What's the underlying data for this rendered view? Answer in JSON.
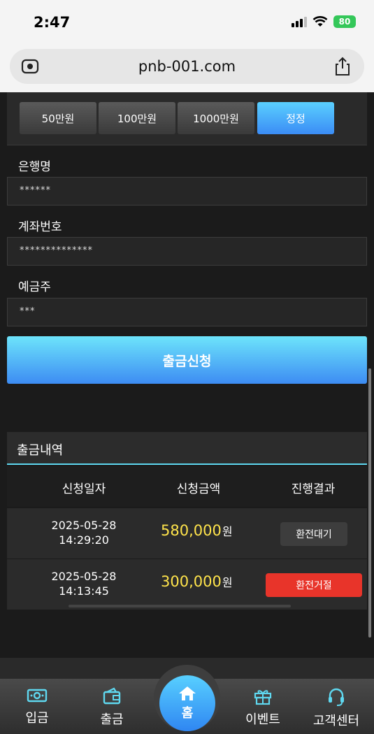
{
  "status_bar": {
    "time": "2:47",
    "battery": "80"
  },
  "browser": {
    "url": "pnb-001.com"
  },
  "amount_buttons": [
    {
      "label": "50만원"
    },
    {
      "label": "100만원"
    },
    {
      "label": "1000만원"
    },
    {
      "label": "정정"
    }
  ],
  "form": {
    "bank_label": "은행명",
    "bank_value": "******",
    "account_label": "계좌번호",
    "account_value": "**************",
    "holder_label": "예금주",
    "holder_value": "***",
    "submit_label": "출금신청"
  },
  "history": {
    "title": "출금내역",
    "columns": [
      "신청일자",
      "신청금액",
      "진행결과"
    ],
    "rows": [
      {
        "date": "2025-05-28",
        "time": "14:29:20",
        "amount": "580,000",
        "unit": "원",
        "status": "환전대기"
      },
      {
        "date": "2025-05-28",
        "time": "14:13:45",
        "amount": "300,000",
        "unit": "원",
        "status": "환전거절"
      }
    ]
  },
  "bottom_nav": {
    "deposit": "입금",
    "withdraw": "출금",
    "home": "홈",
    "event": "이벤트",
    "support": "고객센터"
  },
  "colors": {
    "accent_blue": "#3b8cf5",
    "amount_yellow": "#ffe44b",
    "reject_red": "#e8342a",
    "icon_cyan": "#5fd8f0"
  }
}
